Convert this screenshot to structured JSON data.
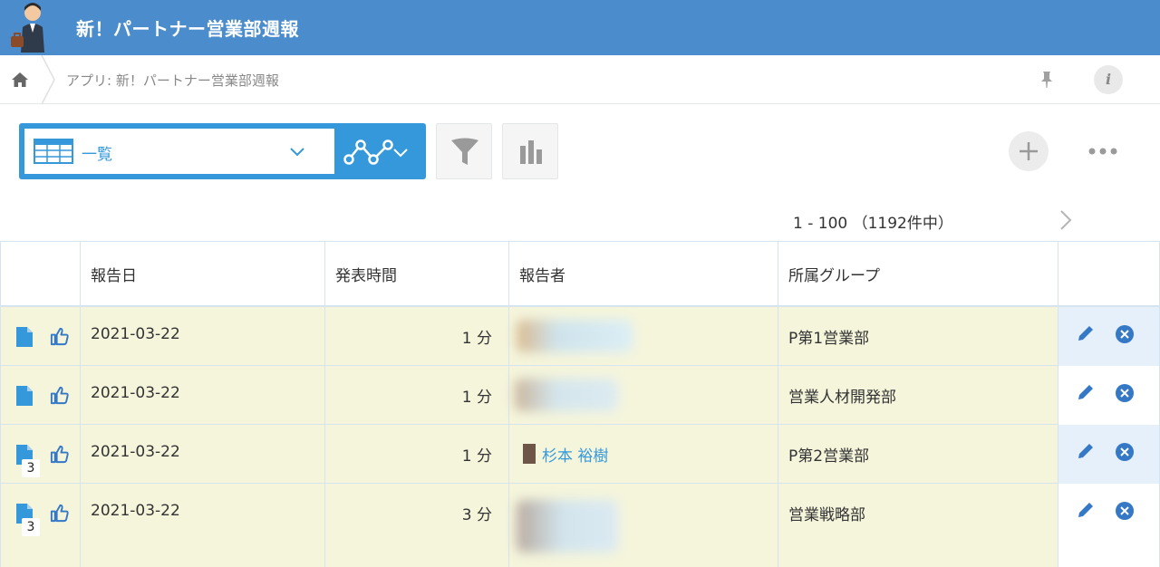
{
  "app": {
    "title": "新！パートナー営業部週報"
  },
  "breadcrumb": {
    "path": "アプリ: 新！パートナー営業部週報",
    "info_glyph": "i"
  },
  "toolbar": {
    "view_label": "一覧"
  },
  "pagination": {
    "text": "1 - 100 （1192件中）"
  },
  "table": {
    "headers": [
      "報告日",
      "発表時間",
      "報告者",
      "所属グループ"
    ],
    "rows": [
      {
        "date": "2021-03-22",
        "duration": "1 分",
        "reporter": "",
        "group": "P第1営業部",
        "comment_count": ""
      },
      {
        "date": "2021-03-22",
        "duration": "1 分",
        "reporter": "",
        "group": "営業人材開発部",
        "comment_count": ""
      },
      {
        "date": "2021-03-22",
        "duration": "1 分",
        "reporter": "杉本 裕樹",
        "group": "P第2営業部",
        "comment_count": "3"
      },
      {
        "date": "2021-03-22",
        "duration": "3 分",
        "reporter": "",
        "group": "営業戦略部",
        "comment_count": "3"
      }
    ]
  },
  "colors": {
    "header_bg": "#4b8dcc",
    "accent": "#3498db",
    "row_bg": "#f5f5dc",
    "grid": "#d6e4f0"
  }
}
